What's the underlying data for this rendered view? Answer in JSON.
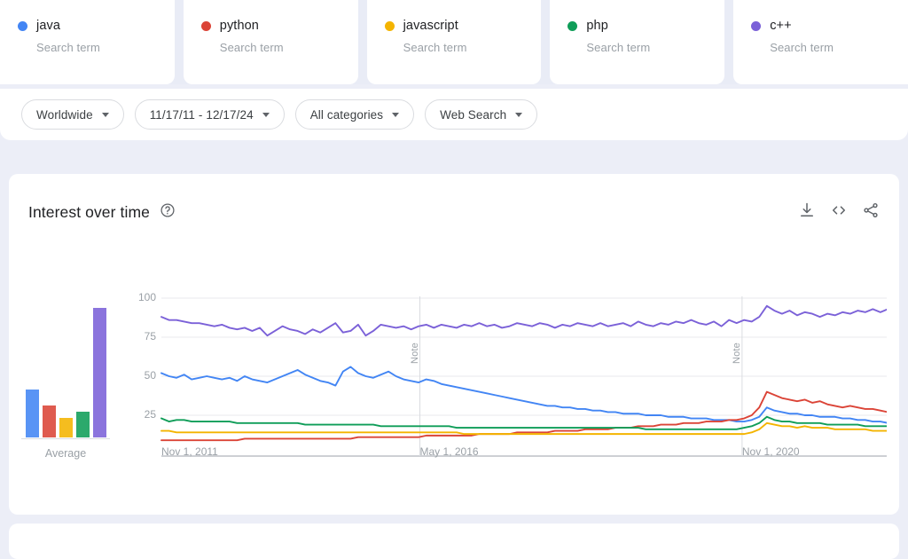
{
  "terms": [
    {
      "name": "java",
      "subtitle": "Search term",
      "color": "#4285F4"
    },
    {
      "name": "python",
      "subtitle": "Search term",
      "color": "#DB4437"
    },
    {
      "name": "javascript",
      "subtitle": "Search term",
      "color": "#F4B400"
    },
    {
      "name": "php",
      "subtitle": "Search term",
      "color": "#0F9D58"
    },
    {
      "name": "c++",
      "subtitle": "Search term",
      "color": "#7B61D8"
    }
  ],
  "filters": [
    {
      "label": "Worldwide",
      "icon": "chevron-down-icon"
    },
    {
      "label": "11/17/11 - 12/17/24",
      "icon": "chevron-down-icon"
    },
    {
      "label": "All categories",
      "icon": "chevron-down-icon"
    },
    {
      "label": "Web Search",
      "icon": "chevron-down-icon"
    }
  ],
  "interest_over_time": {
    "title": "Interest over time",
    "help_icon": "help-circle-icon",
    "actions": [
      {
        "name": "download-icon"
      },
      {
        "name": "embed-code-icon"
      },
      {
        "name": "share-icon"
      }
    ],
    "average_label": "Average"
  },
  "chart_data": {
    "type": "line",
    "title": "Interest over time",
    "xlabel": "",
    "ylabel": "",
    "ylim": [
      0,
      100
    ],
    "grid": true,
    "legend_position": "top",
    "x_tick_labels": [
      "Nov 1, 2011",
      "May 1, 2016",
      "Nov 1, 2020"
    ],
    "x_tick_positions": [
      0,
      0.345,
      0.775
    ],
    "y_ticks": [
      25,
      50,
      75,
      100
    ],
    "annotations": [
      {
        "label": "Note",
        "x": 0.345
      },
      {
        "label": "Note",
        "x": 0.775
      }
    ],
    "average_bars": {
      "categories": [
        "java",
        "python",
        "javascript",
        "php",
        "c++"
      ],
      "values": [
        32,
        21,
        13,
        17,
        86
      ]
    },
    "series": [
      {
        "name": "java",
        "color": "#4285F4",
        "values": [
          52,
          50,
          49,
          51,
          48,
          49,
          50,
          49,
          48,
          49,
          47,
          50,
          48,
          47,
          46,
          48,
          50,
          52,
          54,
          51,
          49,
          47,
          46,
          44,
          53,
          56,
          52,
          50,
          49,
          51,
          53,
          50,
          48,
          47,
          46,
          48,
          47,
          45,
          44,
          43,
          42,
          41,
          40,
          39,
          38,
          37,
          36,
          35,
          34,
          33,
          32,
          31,
          31,
          30,
          30,
          29,
          29,
          28,
          28,
          27,
          27,
          26,
          26,
          26,
          25,
          25,
          25,
          24,
          24,
          24,
          23,
          23,
          23,
          22,
          22,
          22,
          21,
          21,
          22,
          24,
          30,
          28,
          27,
          26,
          26,
          25,
          25,
          24,
          24,
          24,
          23,
          23,
          22,
          22,
          21,
          21,
          20,
          20,
          20,
          19
        ]
      },
      {
        "name": "python",
        "color": "#DB4437",
        "values": [
          9,
          9,
          9,
          9,
          9,
          9,
          9,
          9,
          9,
          9,
          9,
          10,
          10,
          10,
          10,
          10,
          10,
          10,
          10,
          10,
          10,
          10,
          10,
          10,
          10,
          10,
          11,
          11,
          11,
          11,
          11,
          11,
          11,
          11,
          11,
          12,
          12,
          12,
          12,
          12,
          12,
          12,
          13,
          13,
          13,
          13,
          13,
          14,
          14,
          14,
          14,
          14,
          15,
          15,
          15,
          15,
          16,
          16,
          16,
          16,
          17,
          17,
          17,
          18,
          18,
          18,
          19,
          19,
          19,
          20,
          20,
          20,
          21,
          21,
          21,
          22,
          22,
          23,
          25,
          30,
          40,
          38,
          36,
          35,
          34,
          35,
          33,
          34,
          32,
          31,
          30,
          31,
          30,
          29,
          29,
          28,
          27,
          28,
          27,
          27
        ]
      },
      {
        "name": "javascript",
        "color": "#F4B400",
        "values": [
          15,
          15,
          14,
          14,
          14,
          14,
          14,
          14,
          14,
          14,
          14,
          14,
          14,
          14,
          14,
          14,
          14,
          14,
          14,
          14,
          14,
          14,
          14,
          14,
          14,
          14,
          14,
          14,
          14,
          14,
          14,
          14,
          14,
          14,
          14,
          14,
          14,
          14,
          14,
          14,
          13,
          13,
          13,
          13,
          13,
          13,
          13,
          13,
          13,
          13,
          13,
          13,
          13,
          13,
          13,
          13,
          13,
          13,
          13,
          13,
          13,
          13,
          13,
          13,
          13,
          13,
          13,
          13,
          13,
          13,
          13,
          13,
          13,
          13,
          13,
          13,
          13,
          13,
          14,
          16,
          20,
          19,
          18,
          18,
          17,
          18,
          17,
          17,
          17,
          16,
          16,
          16,
          16,
          16,
          15,
          15,
          15,
          15,
          14,
          14
        ]
      },
      {
        "name": "php",
        "color": "#0F9D58",
        "values": [
          23,
          21,
          22,
          22,
          21,
          21,
          21,
          21,
          21,
          21,
          20,
          20,
          20,
          20,
          20,
          20,
          20,
          20,
          20,
          19,
          19,
          19,
          19,
          19,
          19,
          19,
          19,
          19,
          19,
          18,
          18,
          18,
          18,
          18,
          18,
          18,
          18,
          18,
          18,
          17,
          17,
          17,
          17,
          17,
          17,
          17,
          17,
          17,
          17,
          17,
          17,
          17,
          17,
          17,
          17,
          17,
          17,
          17,
          17,
          17,
          17,
          17,
          17,
          17,
          16,
          16,
          16,
          16,
          16,
          16,
          16,
          16,
          16,
          16,
          16,
          16,
          16,
          17,
          18,
          20,
          24,
          22,
          21,
          21,
          20,
          20,
          20,
          20,
          19,
          19,
          19,
          19,
          19,
          18,
          18,
          18,
          18,
          18,
          18,
          18
        ]
      },
      {
        "name": "c++",
        "color": "#7B61D8",
        "values": [
          88,
          86,
          86,
          85,
          84,
          84,
          83,
          82,
          83,
          81,
          80,
          81,
          79,
          81,
          76,
          79,
          82,
          80,
          79,
          77,
          80,
          78,
          81,
          84,
          78,
          79,
          83,
          76,
          79,
          83,
          82,
          81,
          82,
          80,
          82,
          83,
          81,
          83,
          82,
          81,
          83,
          82,
          84,
          82,
          83,
          81,
          82,
          84,
          83,
          82,
          84,
          83,
          81,
          83,
          82,
          84,
          83,
          82,
          84,
          82,
          83,
          84,
          82,
          85,
          83,
          82,
          84,
          83,
          85,
          84,
          86,
          84,
          83,
          85,
          82,
          86,
          84,
          86,
          85,
          88,
          95,
          92,
          90,
          92,
          89,
          91,
          90,
          88,
          90,
          89,
          91,
          90,
          92,
          91,
          93,
          91,
          93,
          92,
          94,
          96
        ]
      }
    ]
  }
}
